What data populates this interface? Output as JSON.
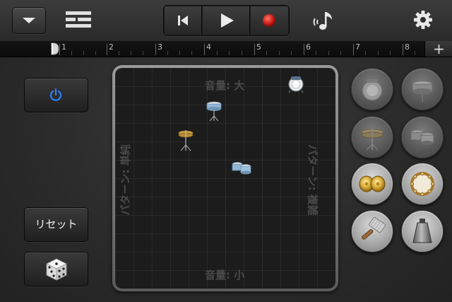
{
  "toolbar": {
    "dropdown_icon": "chevron-down-icon",
    "tracks_icon": "tracks-view-icon",
    "transport": {
      "previous_icon": "skip-to-start-icon",
      "play_icon": "play-icon",
      "record_icon": "record-icon"
    },
    "instrument_icon": "instrument-browser-icon",
    "settings_icon": "gear-icon"
  },
  "ruler": {
    "marks": [
      "1",
      "2",
      "3",
      "4",
      "5",
      "6",
      "7",
      "8"
    ],
    "add_label": "+"
  },
  "left_panel": {
    "power_icon": "power-icon",
    "reset_label": "リセット",
    "dice_icon": "dice-icon"
  },
  "pad": {
    "label_top": "音量: 大",
    "label_bottom": "音量: 小",
    "label_left": "パターン: 単純",
    "label_right": "パターン: 複雑",
    "items": [
      "kick-drum",
      "snare-drum",
      "hi-hat",
      "toms"
    ]
  },
  "instruments": [
    {
      "name": "kick-drum",
      "active": false
    },
    {
      "name": "snare-drum",
      "active": false
    },
    {
      "name": "hi-hat",
      "active": false
    },
    {
      "name": "toms",
      "active": false
    },
    {
      "name": "crash-cymbals",
      "active": true
    },
    {
      "name": "tambourine",
      "active": true
    },
    {
      "name": "shaker",
      "active": true
    },
    {
      "name": "cowbell",
      "active": true
    }
  ],
  "colors": {
    "power_accent": "#2f7fff",
    "record": "#d0201a"
  }
}
